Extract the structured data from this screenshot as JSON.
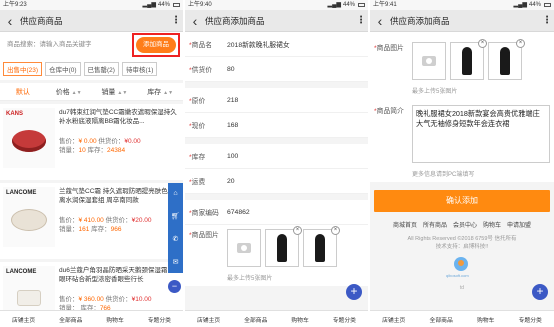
{
  "status": {
    "p1": {
      "time": "上午9:23",
      "battery": "44%"
    },
    "p2": {
      "time": "上午9:40",
      "battery": "44%"
    },
    "p3": {
      "time": "上午9:41",
      "battery": "44%"
    }
  },
  "list_page": {
    "title": "供应商商品",
    "search_label": "商品搜索：请输入商品关键字",
    "add_button": "添加商品",
    "status_tabs": [
      "出售中(23)",
      "仓库中(0)",
      "已售罄(2)",
      "待审核(1)"
    ],
    "sort_tabs": [
      "默认",
      "价格",
      "销量",
      "库存"
    ],
    "products": [
      {
        "name": "du7韩束红润气垫CC霜嫩农遮暇保湿持久补水粉底液隔离BB霜化妆品...",
        "price_label": "售价：",
        "price": "¥ 0.00",
        "supply_label": "供货价：",
        "supply": "¥0.00",
        "sales_label": "销量：",
        "sales": "10",
        "stock_label": "库存：",
        "stock": "24384",
        "brand": "KANS"
      },
      {
        "name": "兰蔻气垫CC霜 持久遮瑕防晒提亮肤色隔离水润保湿套组 周卒南同款",
        "price_label": "售价：",
        "price": "¥ 410.00",
        "supply_label": "供货价：",
        "supply": "¥20.00",
        "sales_label": "销量：",
        "sales": "161",
        "stock_label": "库存：",
        "stock": "966",
        "brand": "LANCOME"
      },
      {
        "name": "du6兰蔻户角羽晶防晒采天鹅颈保湿霜 5层眼环砧合新型浓密香眼些行长",
        "price_label": "售价：",
        "price": "¥ 360.00",
        "supply_label": "供货价：",
        "supply": "¥10.00",
        "sales_label": "销量：",
        "sales": "",
        "stock_label": "库存：",
        "stock": "766",
        "brand": "LANCOME"
      }
    ],
    "float_icons": [
      "home-icon",
      "cart-icon",
      "phone-icon",
      "mail-icon"
    ],
    "close_fab": "−"
  },
  "bottom_nav": [
    "店铺主页",
    "全部商品",
    "购物车",
    "专题分类"
  ],
  "add_page": {
    "title": "供应商添加商品",
    "fields": [
      {
        "label": "商品名",
        "value": "2018新款晚礼服裙女"
      },
      {
        "label": "供货价",
        "value": "80"
      },
      {
        "label": "原价",
        "value": "218"
      },
      {
        "label": "现价",
        "value": "168"
      },
      {
        "label": "库存",
        "value": "100"
      },
      {
        "label": "运费",
        "value": "20"
      },
      {
        "label": "商家编码",
        "value": "674862"
      }
    ],
    "image_label": "商品图片",
    "image_hint": "最多上传5张图片",
    "fab": "+"
  },
  "add_page_2": {
    "title": "供应商添加商品",
    "image_label": "商品图片",
    "image_hint": "最多上传5张图片",
    "desc_label": "商品简介",
    "desc_value": "晚礼服裙女2018新款宴会高贵优雅端庄大气无袖修身短款年会连衣裙",
    "desc_hint": "更多信息请到PC端填写",
    "confirm": "确认添加",
    "links": [
      "商城首页",
      "所有商品",
      "会员中心",
      "购物车",
      "申请加盟"
    ],
    "copyright": "All Rights Reserved ©2018 6759号 信托所有",
    "tech": "技术支持：启博科技!!",
    "logo_text": "qibosoft.com",
    "tdx": "td"
  },
  "colors": {
    "accent": "#ff7d1a",
    "highlight_border": "#e22222",
    "price": "#ff6600",
    "float_bar": "#2e6fc7",
    "fab": "#3c59c5"
  }
}
